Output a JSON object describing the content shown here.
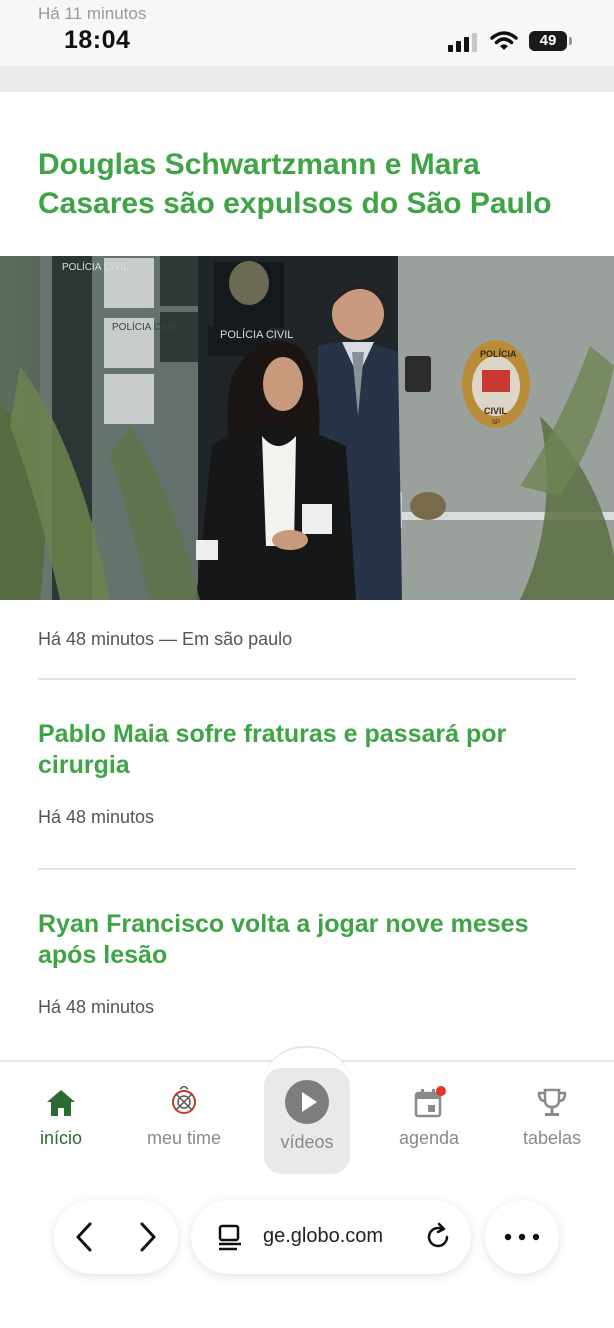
{
  "status_bar": {
    "faded_time": "Há 11 minutos",
    "clock": "18:04",
    "battery": "49",
    "battery_level": 0.49
  },
  "articles": [
    {
      "headline": "Douglas Schwartzmann e Mara Casares são expulsos do São Paulo",
      "meta": "Há 48 minutos — Em são paulo",
      "image_text": {
        "sign1": "POLÍCIA CIVIL",
        "sign2": "POLÍCIA CIVIL",
        "sign3": "POLÍCIA CIVIL",
        "badge_top": "POLÍCIA",
        "badge_bottom": "CIVIL",
        "badge_sp": "SP"
      }
    },
    {
      "headline": "Pablo Maia sofre fraturas e passará por cirurgia",
      "meta": "Há 48 minutos"
    },
    {
      "headline": "Ryan Francisco volta a jogar nove meses após lesão",
      "meta": "Há 48 minutos"
    }
  ],
  "bottom_nav": {
    "items": [
      {
        "label": "início",
        "icon": "home-icon",
        "active": true
      },
      {
        "label": "meu time",
        "icon": "team-crest-icon",
        "active": false
      },
      {
        "label": "vídeos",
        "icon": "play-icon",
        "active": false
      },
      {
        "label": "agenda",
        "icon": "calendar-icon",
        "active": false,
        "badge": true
      },
      {
        "label": "tabelas",
        "icon": "trophy-icon",
        "active": false
      }
    ]
  },
  "browser": {
    "url": "ge.globo.com"
  },
  "colors": {
    "headline_green": "#3fa445",
    "active_nav": "#2b6b2f",
    "inactive_nav": "#8a8a8a",
    "badge_red": "#e8322b"
  }
}
